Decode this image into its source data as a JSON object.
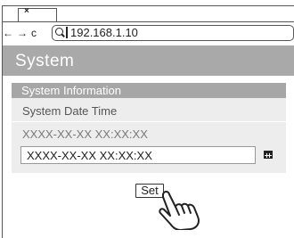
{
  "browser": {
    "tab_close": "×",
    "nav_back": "←",
    "nav_forward": "→",
    "nav_reload": "c",
    "url": "192.168.1.10"
  },
  "page": {
    "title": "System"
  },
  "panel": {
    "header": "System Information",
    "section_label": "System Date Time",
    "datetime_placeholder": "XXXX-XX-XX XX:XX:XX",
    "datetime_value": "XXXX-XX-XX XX:XX:XX"
  },
  "actions": {
    "set_label": "Set"
  },
  "icons": {
    "calendar": "calendar-icon",
    "search": "search-icon",
    "pointer": "hand-pointer-icon"
  }
}
